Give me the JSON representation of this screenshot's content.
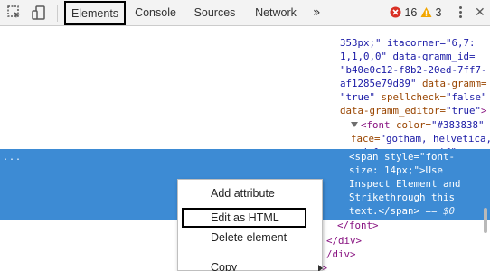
{
  "toolbar": {
    "icons": {
      "inspect": "cursor-select-icon",
      "device": "device-toggle-icon"
    },
    "tabs": [
      {
        "label": "Elements",
        "active": true
      },
      {
        "label": "Console",
        "active": false
      },
      {
        "label": "Sources",
        "active": false
      },
      {
        "label": "Network",
        "active": false
      }
    ],
    "more_tabs": "»",
    "errors": "16",
    "warnings": "3",
    "error_color": "#d93025",
    "warning_color": "#f2a600"
  },
  "code": {
    "l1": "353px;\" itacorner=\"6,7:",
    "l2": "1,1,0,0\" data-gramm_id=",
    "l3": "\"b40e0c12-f8b2-20ed-7ff7-",
    "l4a": "af1285e79d89\"",
    "l4b": " data-gramm=",
    "l5a": "\"true\"",
    "l5b": " spellcheck=",
    "l5c": "\"false\"",
    "l6a": "data-gramm_editor=",
    "l6b": "\"true\"",
    "l6c": ">",
    "l7a": "<font",
    "l7b": " color=",
    "l7c": "\"#383838\"",
    "l8a": "face=",
    "l8b": "\"gotham, helvetica,",
    "l9a": "arial, sans-serif\"",
    "l9b": ">",
    "sel_dots": "...",
    "s1": "<span style=\"font-",
    "s2": "size: 14px;\">Use",
    "s3": "Inspect Element and",
    "s4": "Strikethrough this",
    "s5a": "text.</span>",
    "s5b": " == $0",
    "c1": "</font>",
    "c2": "</div>",
    "c3": "/div>",
    "c4": "d>"
  },
  "context_menu": {
    "items": [
      "Add attribute",
      "Edit as HTML",
      "Delete element",
      "Copy"
    ]
  }
}
